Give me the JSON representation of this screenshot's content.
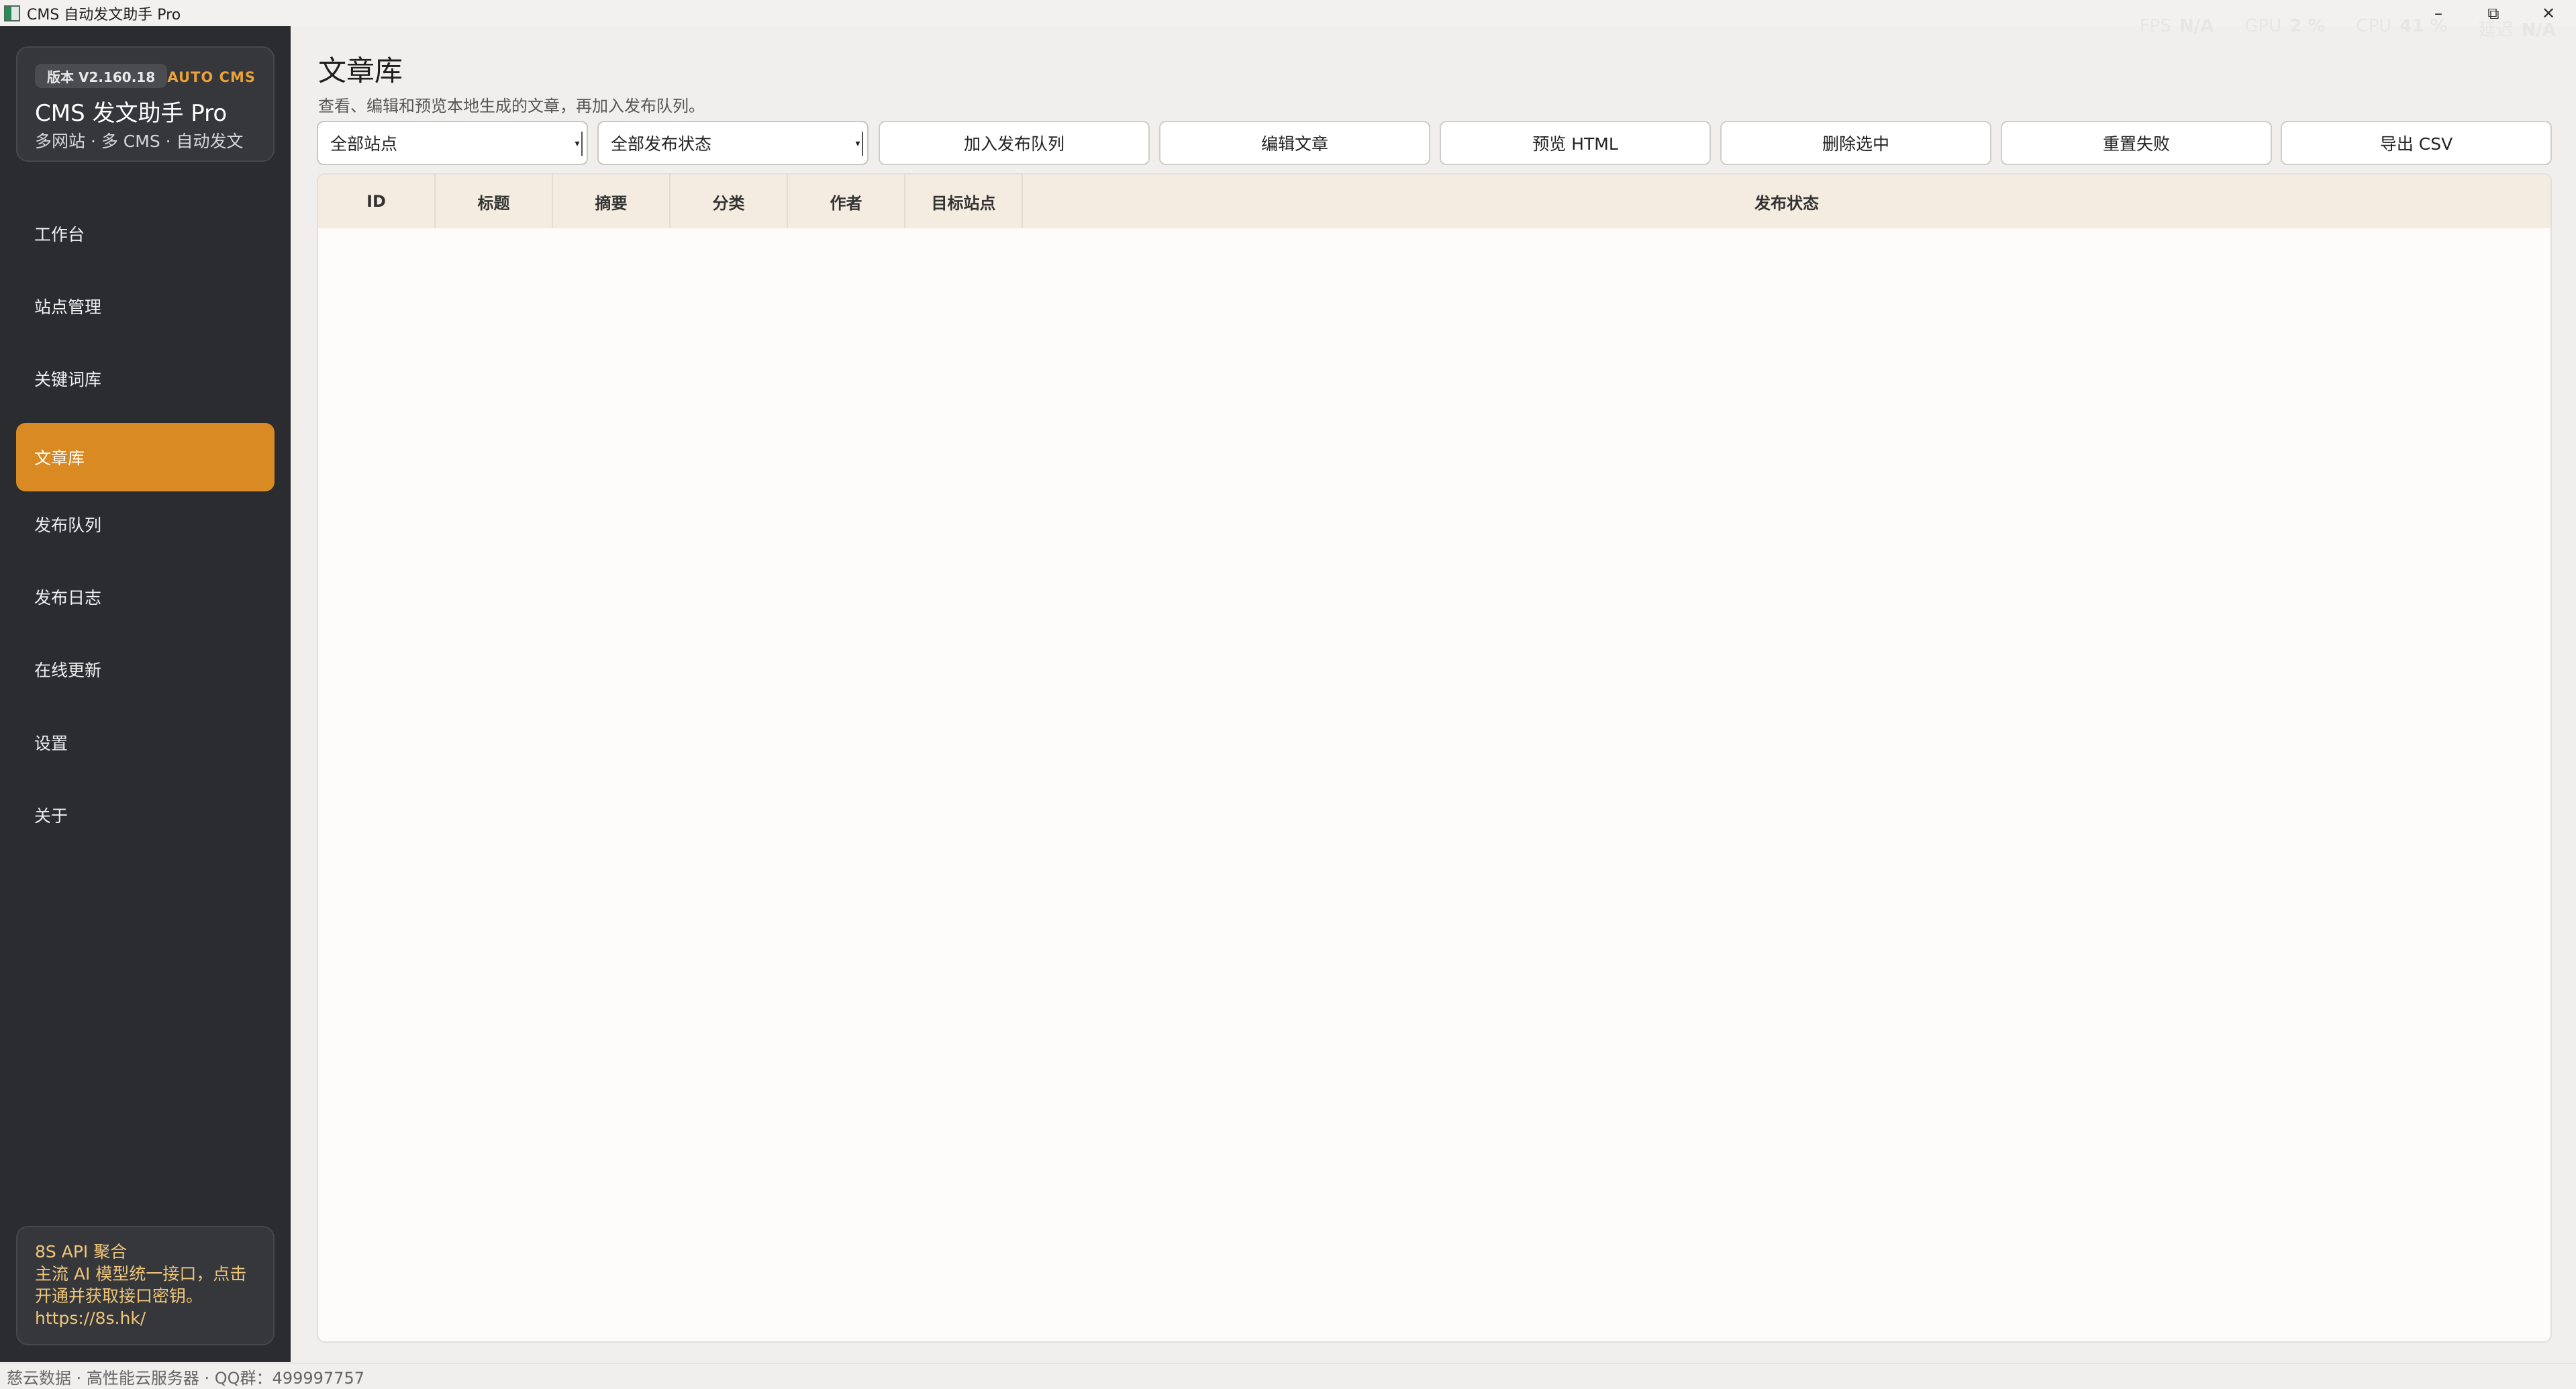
{
  "window": {
    "title": "CMS 自动发文助手 Pro",
    "controls": [
      "–",
      "⧉",
      "✕"
    ]
  },
  "metrics": [
    {
      "label": "FPS",
      "value": "N/A"
    },
    {
      "label": "GPU",
      "value": "2 %"
    },
    {
      "label": "CPU",
      "value": "41 %"
    },
    {
      "label": "延迟",
      "value": "N/A"
    }
  ],
  "brand": {
    "version": "版本 V2.160.18",
    "tag": "AUTO CMS",
    "title": "CMS 发文助手 Pro",
    "subtitle": "多网站 · 多 CMS · 自动发文"
  },
  "nav": {
    "items": [
      {
        "label": "工作台",
        "active": false
      },
      {
        "label": "站点管理",
        "active": false
      },
      {
        "label": "关键词库",
        "active": false
      },
      {
        "label": "文章库",
        "active": true
      },
      {
        "label": "发布队列",
        "active": false
      },
      {
        "label": "发布日志",
        "active": false
      },
      {
        "label": "在线更新",
        "active": false
      },
      {
        "label": "设置",
        "active": false
      },
      {
        "label": "关于",
        "active": false
      }
    ]
  },
  "promo": {
    "title": "8S API 聚合",
    "body": "主流 AI 模型统一接口，点击开通并获取接口密钥。",
    "url": "https://8s.hk/"
  },
  "page": {
    "title": "文章库",
    "subtitle": "查看、编辑和预览本地生成的文章，再加入发布队列。"
  },
  "toolbar": {
    "site_filter": "全部站点",
    "status_filter": "全部发布状态",
    "buttons": [
      "加入发布队列",
      "编辑文章",
      "预览 HTML",
      "删除选中",
      "重置失败",
      "导出 CSV"
    ]
  },
  "table": {
    "columns": [
      "ID",
      "标题",
      "摘要",
      "分类",
      "作者",
      "目标站点",
      "发布状态"
    ],
    "rows": []
  },
  "statusbar": {
    "text": "慈云数据 · 高性能云服务器 · QQ群：499997757"
  },
  "colors": {
    "accent": "#d98a22",
    "sidebar_bg": "#2a2c2f",
    "table_header_bg": "#f4ece1"
  }
}
